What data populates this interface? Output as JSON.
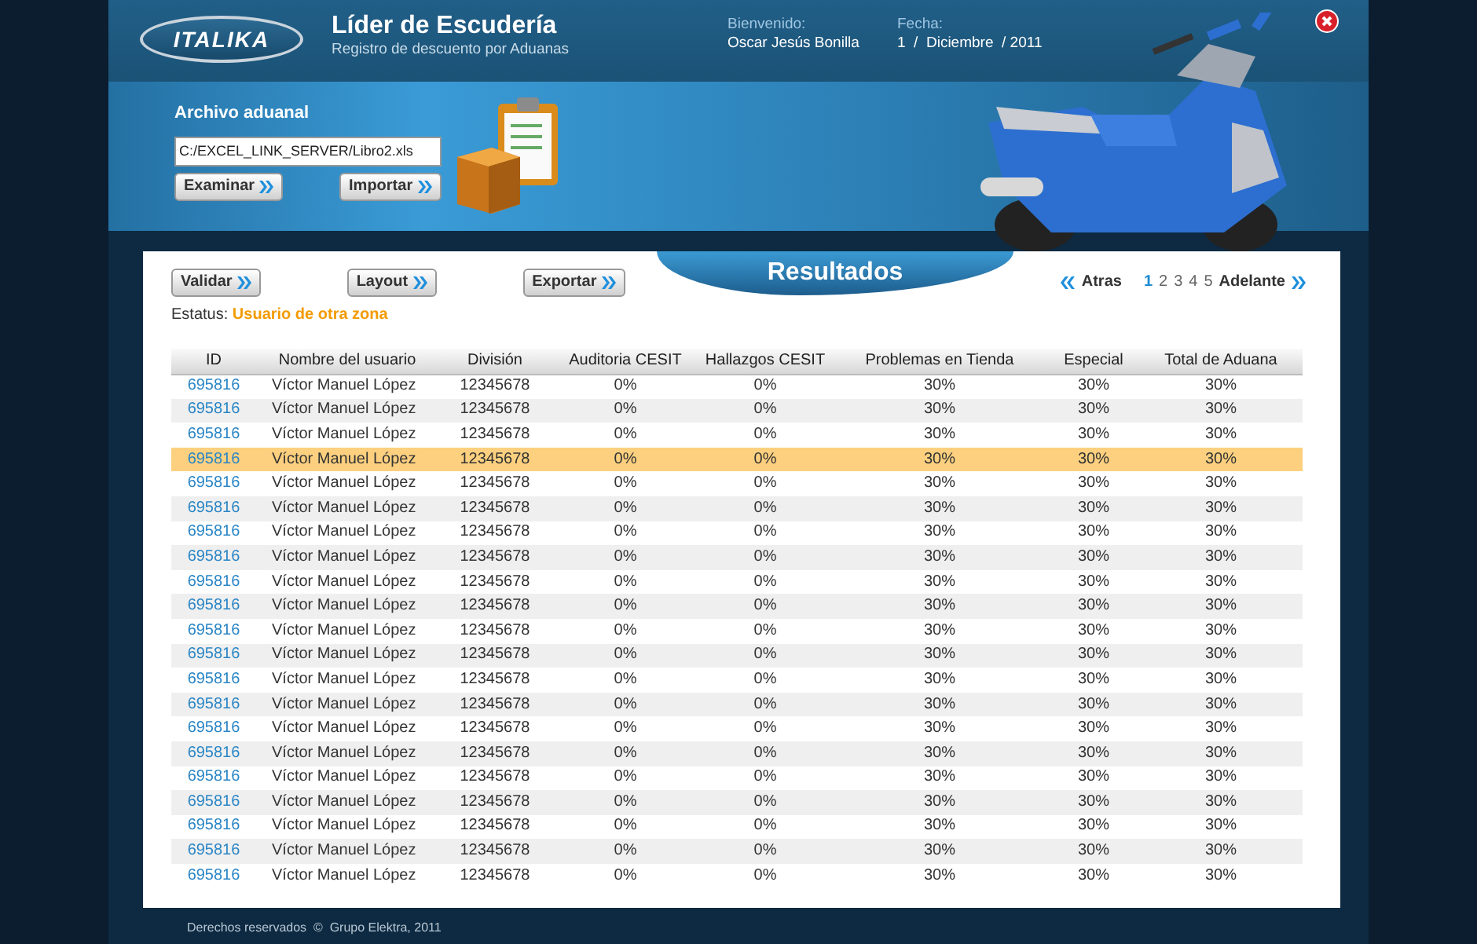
{
  "header": {
    "logo_text": "ITALIKA",
    "title": "Líder de Escudería",
    "subtitle": "Registro de descuento por Aduanas",
    "welcome_label": "Bienvenido:",
    "user": "Oscar Jesús Bonilla",
    "date_label": "Fecha:",
    "date": "1  /  Diciembre  / 2011"
  },
  "import": {
    "label": "Archivo aduanal",
    "path": "C:/EXCEL_LINK_SERVER/Libro2.xls",
    "buttons": [
      "Examinar",
      "Importar"
    ]
  },
  "results": {
    "title": "Resultados",
    "actions": [
      "Validar",
      "Layout",
      "Exportar"
    ],
    "status_label": "Estatus:",
    "status": "Usuario de otra zona",
    "pager": {
      "prev": "Atras",
      "next": "Adelante",
      "pages": [
        {
          "label": "1",
          "selected": true
        },
        {
          "label": "2",
          "selected": false
        },
        {
          "label": "3",
          "selected": false
        },
        {
          "label": "4",
          "selected": false
        },
        {
          "label": "5",
          "selected": false
        }
      ]
    }
  },
  "table": {
    "columns": [
      "ID",
      "Nombre del usuario",
      "División",
      "Auditoria CESIT",
      "Hallazgos CESIT",
      "Problemas en Tienda",
      "Especial",
      "Total de Aduana"
    ],
    "rows": [
      {
        "cells": [
          "695816",
          "Víctor Manuel López",
          "12345678",
          "0%",
          "0%",
          "30%",
          "30%",
          "30%"
        ],
        "selected": false
      },
      {
        "cells": [
          "695816",
          "Víctor Manuel López",
          "12345678",
          "0%",
          "0%",
          "30%",
          "30%",
          "30%"
        ],
        "selected": false
      },
      {
        "cells": [
          "695816",
          "Víctor Manuel López",
          "12345678",
          "0%",
          "0%",
          "30%",
          "30%",
          "30%"
        ],
        "selected": false
      },
      {
        "cells": [
          "695816",
          "Víctor Manuel López",
          "12345678",
          "0%",
          "0%",
          "30%",
          "30%",
          "30%"
        ],
        "selected": true
      },
      {
        "cells": [
          "695816",
          "Víctor Manuel López",
          "12345678",
          "0%",
          "0%",
          "30%",
          "30%",
          "30%"
        ],
        "selected": false
      },
      {
        "cells": [
          "695816",
          "Víctor Manuel López",
          "12345678",
          "0%",
          "0%",
          "30%",
          "30%",
          "30%"
        ],
        "selected": false
      },
      {
        "cells": [
          "695816",
          "Víctor Manuel López",
          "12345678",
          "0%",
          "0%",
          "30%",
          "30%",
          "30%"
        ],
        "selected": false
      },
      {
        "cells": [
          "695816",
          "Víctor Manuel López",
          "12345678",
          "0%",
          "0%",
          "30%",
          "30%",
          "30%"
        ],
        "selected": false
      },
      {
        "cells": [
          "695816",
          "Víctor Manuel López",
          "12345678",
          "0%",
          "0%",
          "30%",
          "30%",
          "30%"
        ],
        "selected": false
      },
      {
        "cells": [
          "695816",
          "Víctor Manuel López",
          "12345678",
          "0%",
          "0%",
          "30%",
          "30%",
          "30%"
        ],
        "selected": false
      },
      {
        "cells": [
          "695816",
          "Víctor Manuel López",
          "12345678",
          "0%",
          "0%",
          "30%",
          "30%",
          "30%"
        ],
        "selected": false
      },
      {
        "cells": [
          "695816",
          "Víctor Manuel López",
          "12345678",
          "0%",
          "0%",
          "30%",
          "30%",
          "30%"
        ],
        "selected": false
      },
      {
        "cells": [
          "695816",
          "Víctor Manuel López",
          "12345678",
          "0%",
          "0%",
          "30%",
          "30%",
          "30%"
        ],
        "selected": false
      },
      {
        "cells": [
          "695816",
          "Víctor Manuel López",
          "12345678",
          "0%",
          "0%",
          "30%",
          "30%",
          "30%"
        ],
        "selected": false
      },
      {
        "cells": [
          "695816",
          "Víctor Manuel López",
          "12345678",
          "0%",
          "0%",
          "30%",
          "30%",
          "30%"
        ],
        "selected": false
      },
      {
        "cells": [
          "695816",
          "Víctor Manuel López",
          "12345678",
          "0%",
          "0%",
          "30%",
          "30%",
          "30%"
        ],
        "selected": false
      },
      {
        "cells": [
          "695816",
          "Víctor Manuel López",
          "12345678",
          "0%",
          "0%",
          "30%",
          "30%",
          "30%"
        ],
        "selected": false
      },
      {
        "cells": [
          "695816",
          "Víctor Manuel López",
          "12345678",
          "0%",
          "0%",
          "30%",
          "30%",
          "30%"
        ],
        "selected": false
      },
      {
        "cells": [
          "695816",
          "Víctor Manuel López",
          "12345678",
          "0%",
          "0%",
          "30%",
          "30%",
          "30%"
        ],
        "selected": false
      },
      {
        "cells": [
          "695816",
          "Víctor Manuel López",
          "12345678",
          "0%",
          "0%",
          "30%",
          "30%",
          "30%"
        ],
        "selected": false
      },
      {
        "cells": [
          "695816",
          "Víctor Manuel López",
          "12345678",
          "0%",
          "0%",
          "30%",
          "30%",
          "30%"
        ],
        "selected": false
      }
    ]
  },
  "footer": {
    "text": "Derechos reservados  ©  Grupo Elektra, 2011"
  }
}
